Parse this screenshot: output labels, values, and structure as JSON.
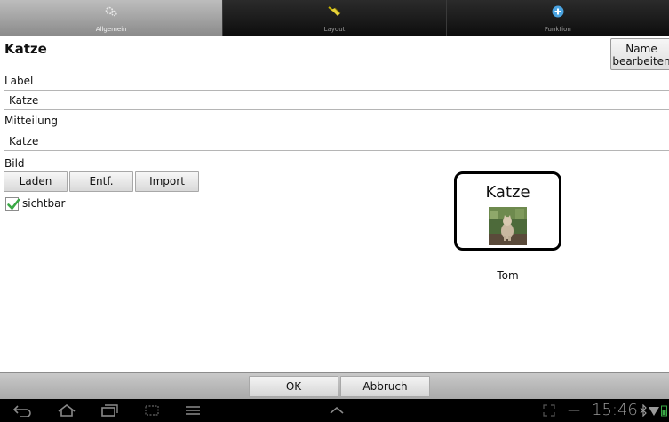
{
  "tabs": [
    {
      "label": "Allgemein",
      "icon": "gears-icon",
      "active": true
    },
    {
      "label": "Layout",
      "icon": "paintbrush-icon",
      "active": false
    },
    {
      "label": "Funktion",
      "icon": "plus-circle-icon",
      "active": false
    }
  ],
  "header": {
    "title": "Katze",
    "name_edit_line1": "Name",
    "name_edit_line2": "bearbeiten"
  },
  "form": {
    "label_caption": "Label",
    "label_value": "Katze",
    "message_caption": "Mitteilung",
    "message_value": "Katze",
    "image_caption": "Bild",
    "load_button": "Laden",
    "remove_button": "Entf.",
    "import_button": "Import",
    "visible_label": "sichtbar",
    "visible_checked": true
  },
  "preview": {
    "card_label": "Katze",
    "voice": "Tom"
  },
  "footer": {
    "ok": "OK",
    "cancel": "Abbruch"
  },
  "system_bar": {
    "clock": "15:46",
    "separator": "—"
  },
  "colors": {
    "check_green": "#3aa845",
    "tab_active": "#a3a3a3",
    "tab_inactive": "#1a1a1a"
  }
}
